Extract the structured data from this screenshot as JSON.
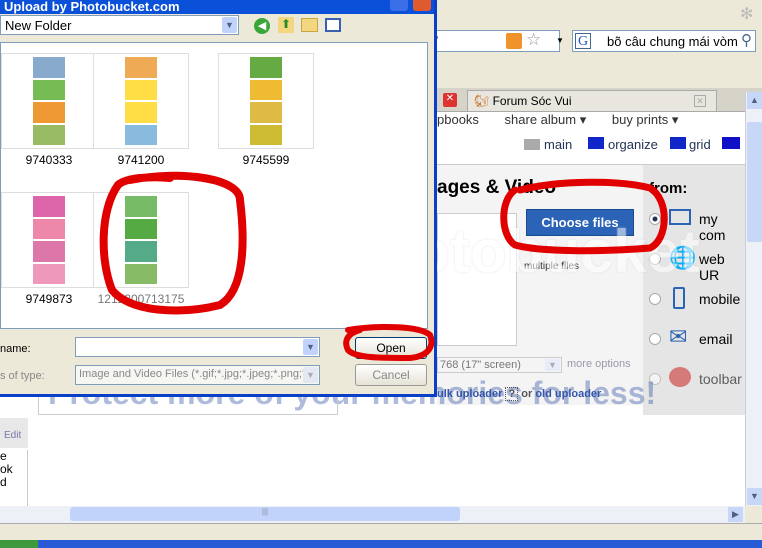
{
  "browser": {
    "address_fragment": "e/",
    "search_engine": "G",
    "search_value": "bõ câu chung mái vòm",
    "tabs": [
      {
        "label": "Forum Sóc Vui"
      }
    ],
    "menu": [
      "pbooks",
      "share album ▾",
      "buy prints ▾"
    ],
    "view_links": [
      "main",
      "organize",
      "grid",
      "s"
    ]
  },
  "page": {
    "heading": "ages & Video",
    "choose_files": "Choose files",
    "multiple_note": "multiple files",
    "from_label": "from:",
    "sources": [
      {
        "label": "my com",
        "selected": true
      },
      {
        "label": "web UR",
        "selected": false
      },
      {
        "label": "mobile",
        "selected": false
      },
      {
        "label": "email",
        "selected": false
      },
      {
        "label": "toolbar",
        "selected": false
      }
    ],
    "resize_value": "768 (17\" screen)",
    "more_options": "more options",
    "uploader_text": "ulk uploader",
    "help": "?",
    "or_text": "or",
    "old_uploader": "old uploader",
    "banner": "Protect more of your memories for less!",
    "watermark": "photobucket",
    "sidebar_edit": "Edit",
    "sidebar_items": [
      "e",
      "ok",
      "d"
    ]
  },
  "dialog": {
    "title": "Upload by Photobucket.com",
    "folder": "New Folder",
    "files": [
      {
        "name": "9740333",
        "colors": [
          "#8ac",
          "#7b5",
          "#e93",
          "#9b6"
        ]
      },
      {
        "name": "9741200",
        "colors": [
          "#ea5",
          "#fd4",
          "#fd4",
          "#8bd"
        ]
      },
      {
        "name": "9745599",
        "colors": [
          "#6a4",
          "#eb3",
          "#db4",
          "#cb3"
        ]
      },
      {
        "name": "9749873",
        "colors": [
          "#d6a",
          "#e8a",
          "#d7a",
          "#e9b"
        ]
      },
      {
        "name": "1212200713175",
        "colors": [
          "#7b6",
          "#5a4",
          "#5a8",
          "#8b6"
        ]
      }
    ],
    "filename_label": "name:",
    "filename_value": "",
    "filetype_label": "s of type:",
    "filetype_value": "Image and Video Files (*.gif;*.jpg;*.jpeg;*.png;*.l",
    "open": "Open",
    "cancel": "Cancel"
  },
  "annotation_color": "#e00000",
  "hscroll_grip": "|||"
}
